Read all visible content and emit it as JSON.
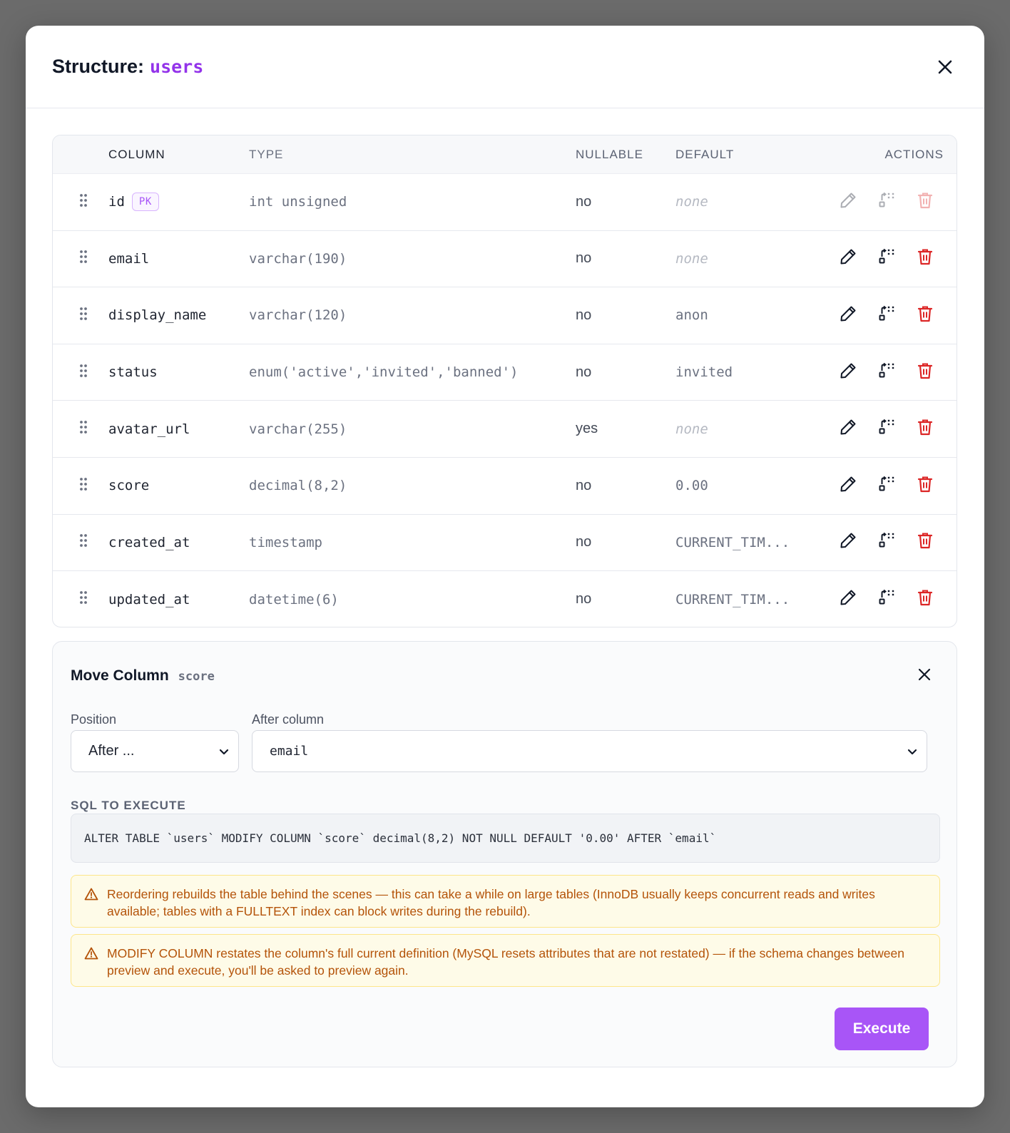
{
  "modal": {
    "title_prefix": "Structure:",
    "table_name": "users"
  },
  "columns_table": {
    "headers": {
      "column": "COLUMN",
      "type": "TYPE",
      "nullable": "NULLABLE",
      "default": "DEFAULT",
      "actions": "ACTIONS"
    },
    "rows": [
      {
        "name": "id",
        "badge": "PK",
        "type": "int unsigned",
        "nullable": "no",
        "default": "none",
        "default_is_none": true,
        "actions_disabled": true
      },
      {
        "name": "email",
        "type": "varchar(190)",
        "nullable": "no",
        "default": "none",
        "default_is_none": true
      },
      {
        "name": "display_name",
        "type": "varchar(120)",
        "nullable": "no",
        "default": "anon"
      },
      {
        "name": "status",
        "type": "enum('active','invited','banned')",
        "nullable": "no",
        "default": "invited"
      },
      {
        "name": "avatar_url",
        "type": "varchar(255)",
        "nullable": "yes",
        "default": "none",
        "default_is_none": true
      },
      {
        "name": "score",
        "type": "decimal(8,2)",
        "nullable": "no",
        "default": "0.00"
      },
      {
        "name": "created_at",
        "type": "timestamp",
        "nullable": "no",
        "default": "CURRENT_TIM..."
      },
      {
        "name": "updated_at",
        "type": "datetime(6)",
        "nullable": "no",
        "default": "CURRENT_TIM..."
      }
    ],
    "icons": {
      "drag": "drag-handle-icon",
      "edit": "pencil-icon",
      "move": "move-column-icon",
      "delete": "trash-icon"
    },
    "colors": {
      "delete": "#dc2626",
      "accent": "#a855f7"
    }
  },
  "move_panel": {
    "title": "Move Column",
    "column": "score",
    "position_label": "Position",
    "position_value": "After ...",
    "after_label": "After column",
    "after_value": "email",
    "sql_label": "SQL TO EXECUTE",
    "sql": "ALTER TABLE `users` MODIFY COLUMN `score` decimal(8,2) NOT NULL DEFAULT '0.00' AFTER `email`",
    "warnings": [
      "Reordering rebuilds the table behind the scenes — this can take a while on large tables (InnoDB usually keeps concurrent reads and writes available; tables with a FULLTEXT index can block writes during the rebuild).",
      "MODIFY COLUMN restates the column's full current definition (MySQL resets attributes that are not restated) — if the schema changes between preview and execute, you'll be asked to preview again."
    ],
    "execute_label": "Execute"
  }
}
